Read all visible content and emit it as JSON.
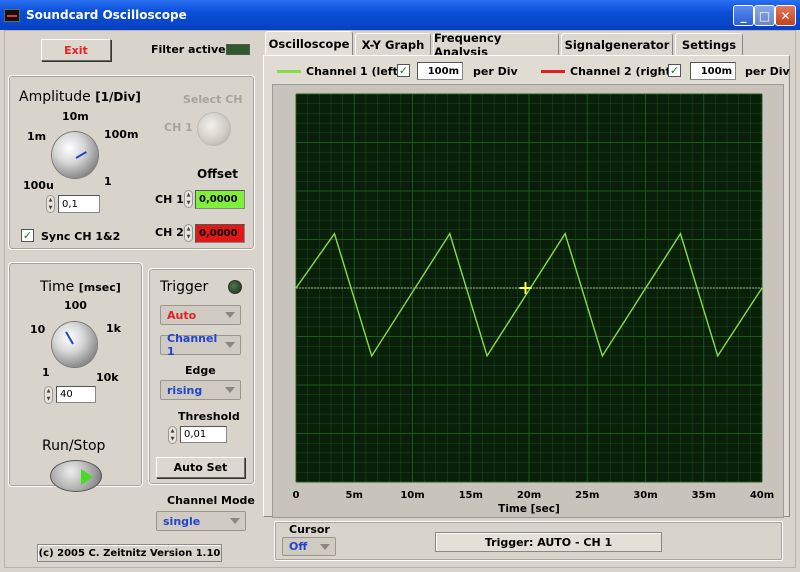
{
  "window": {
    "title": "Soundcard Oscilloscope",
    "minimize": "_",
    "maximize": "□",
    "close": "✕"
  },
  "left": {
    "exit_label": "Exit",
    "filter_label": "Filter active",
    "amplitude": {
      "title": "Amplitude",
      "unit": "[1/Div]",
      "scale": [
        "10m",
        "1m",
        "100m",
        "100u",
        "1"
      ],
      "value": "0,1"
    },
    "select_ch": {
      "title": "Select CH",
      "label": "CH 1"
    },
    "offset": {
      "title": "Offset",
      "ch1_label": "CH 1",
      "ch1_value": "0,0000",
      "ch2_label": "CH 2",
      "ch2_value": "0,0000"
    },
    "sync_label": "Sync CH 1&2",
    "sync_checked": "✓",
    "time": {
      "title": "Time",
      "unit": "[msec]",
      "scale": [
        "100",
        "10",
        "1k",
        "1",
        "10k"
      ],
      "value": "40"
    },
    "runstop_label": "Run/Stop",
    "trigger": {
      "title": "Trigger",
      "mode": "Auto",
      "channel": "Channel 1",
      "edge_label": "Edge",
      "edge": "rising",
      "threshold_label": "Threshold",
      "threshold": "0,01",
      "autoset_label": "Auto Set"
    },
    "channel_mode": {
      "label": "Channel Mode",
      "value": "single"
    },
    "copyright": "(c) 2005 C. Zeitnitz Version 1.10"
  },
  "tabs": [
    "Oscilloscope",
    "X-Y Graph",
    "Frequency Analysis",
    "Signalgenerator",
    "Settings"
  ],
  "channels": {
    "ch1_label": "Channel 1 (left)",
    "ch1_div": "100m",
    "ch1_checked": "✓",
    "ch2_label": "Channel 2 (right)",
    "ch2_div": "100m",
    "ch2_checked": "✓",
    "per_div": "per Div"
  },
  "cursor": {
    "label": "Cursor",
    "value": "Off"
  },
  "status": "Trigger: AUTO - CH 1",
  "colors": {
    "ch1": "#88dd44",
    "ch2": "#e02020",
    "plot_bg": "#0a1f0a",
    "grid": "#1e5a1e"
  },
  "chart_data": {
    "type": "line",
    "xlabel": "Time [sec]",
    "x_ticks": [
      "0",
      "5m",
      "10m",
      "15m",
      "20m",
      "25m",
      "30m",
      "35m",
      "40m"
    ],
    "xlim": [
      0,
      0.04
    ],
    "ylim": [
      -1,
      1
    ],
    "series": [
      {
        "x": [
          0,
          0.0033,
          0.0065,
          0.0132,
          0.0164,
          0.0231,
          0.0263,
          0.033,
          0.0362,
          0.04
        ],
        "y": [
          0,
          0.28,
          -0.35,
          0.28,
          -0.35,
          0.28,
          -0.35,
          0.28,
          -0.35,
          0.0
        ]
      }
    ]
  }
}
